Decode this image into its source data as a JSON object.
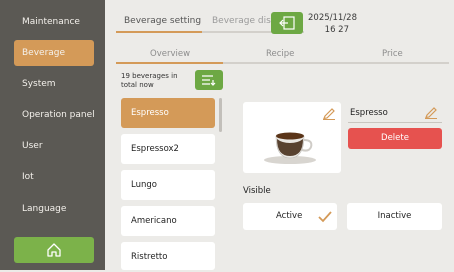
{
  "sidebar": {
    "items": [
      {
        "label": "Maintenance"
      },
      {
        "label": "Beverage"
      },
      {
        "label": "System"
      },
      {
        "label": "Operation panel"
      },
      {
        "label": "User"
      },
      {
        "label": "Iot"
      },
      {
        "label": "Language"
      }
    ]
  },
  "header": {
    "tabs": [
      {
        "label": "Beverage setting"
      },
      {
        "label": "Beverage display"
      }
    ],
    "date": "2025/11/28",
    "time": "16 27"
  },
  "subtabs": [
    {
      "label": "Overview"
    },
    {
      "label": "Recipe"
    },
    {
      "label": "Price"
    }
  ],
  "beverage_list": {
    "count_text_1": "19 beverages in",
    "count_text_2": "total now",
    "items": [
      {
        "label": "Espresso"
      },
      {
        "label": "Espressox2"
      },
      {
        "label": "Lungo"
      },
      {
        "label": "Americano"
      },
      {
        "label": "Ristretto"
      }
    ]
  },
  "detail": {
    "name": "Espresso",
    "delete_label": "Delete",
    "visible_label": "Visible",
    "active_label": "Active",
    "inactive_label": "Inactive"
  },
  "colors": {
    "accent": "#d49a58",
    "green": "#6da844",
    "delete": "#e6524f",
    "sidebar": "#5b5954"
  }
}
